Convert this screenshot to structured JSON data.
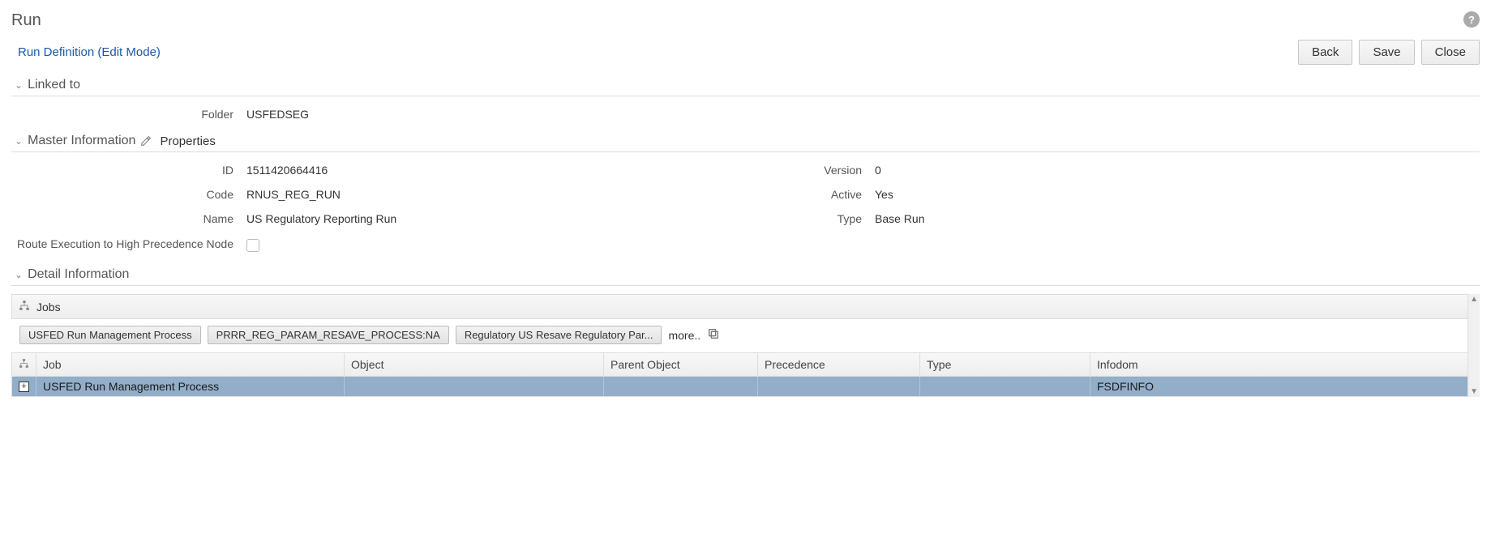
{
  "page": {
    "title": "Run",
    "mode_label": "Run Definition (Edit Mode)"
  },
  "buttons": {
    "back": "Back",
    "save": "Save",
    "close": "Close"
  },
  "sections": {
    "linked_to": {
      "title": "Linked to",
      "fields": {
        "folder_label": "Folder",
        "folder_value": "USFEDSEG"
      }
    },
    "master_info": {
      "title": "Master Information",
      "subtitle": "Properties",
      "fields": {
        "id_label": "ID",
        "id_value": "1511420664416",
        "version_label": "Version",
        "version_value": "0",
        "code_label": "Code",
        "code_value": "RNUS_REG_RUN",
        "active_label": "Active",
        "active_value": "Yes",
        "name_label": "Name",
        "name_value": "US Regulatory Reporting Run",
        "type_label": "Type",
        "type_value": "Base Run",
        "route_label": "Route Execution to High Precedence Node",
        "route_checked": false
      }
    },
    "detail": {
      "title": "Detail Information",
      "jobs_label": "Jobs",
      "tags": [
        "USFED Run Management Process",
        "PRRR_REG_PARAM_RESAVE_PROCESS:NA",
        "Regulatory US Resave Regulatory Par..."
      ],
      "more_label": "more.."
    }
  },
  "grid": {
    "columns": {
      "job": "Job",
      "object": "Object",
      "parent_object": "Parent Object",
      "precedence": "Precedence",
      "type": "Type",
      "infodom": "Infodom"
    },
    "rows": [
      {
        "job": "USFED Run Management Process",
        "object": "",
        "parent_object": "",
        "precedence": "",
        "type": "",
        "infodom": "FSDFINFO"
      }
    ]
  }
}
